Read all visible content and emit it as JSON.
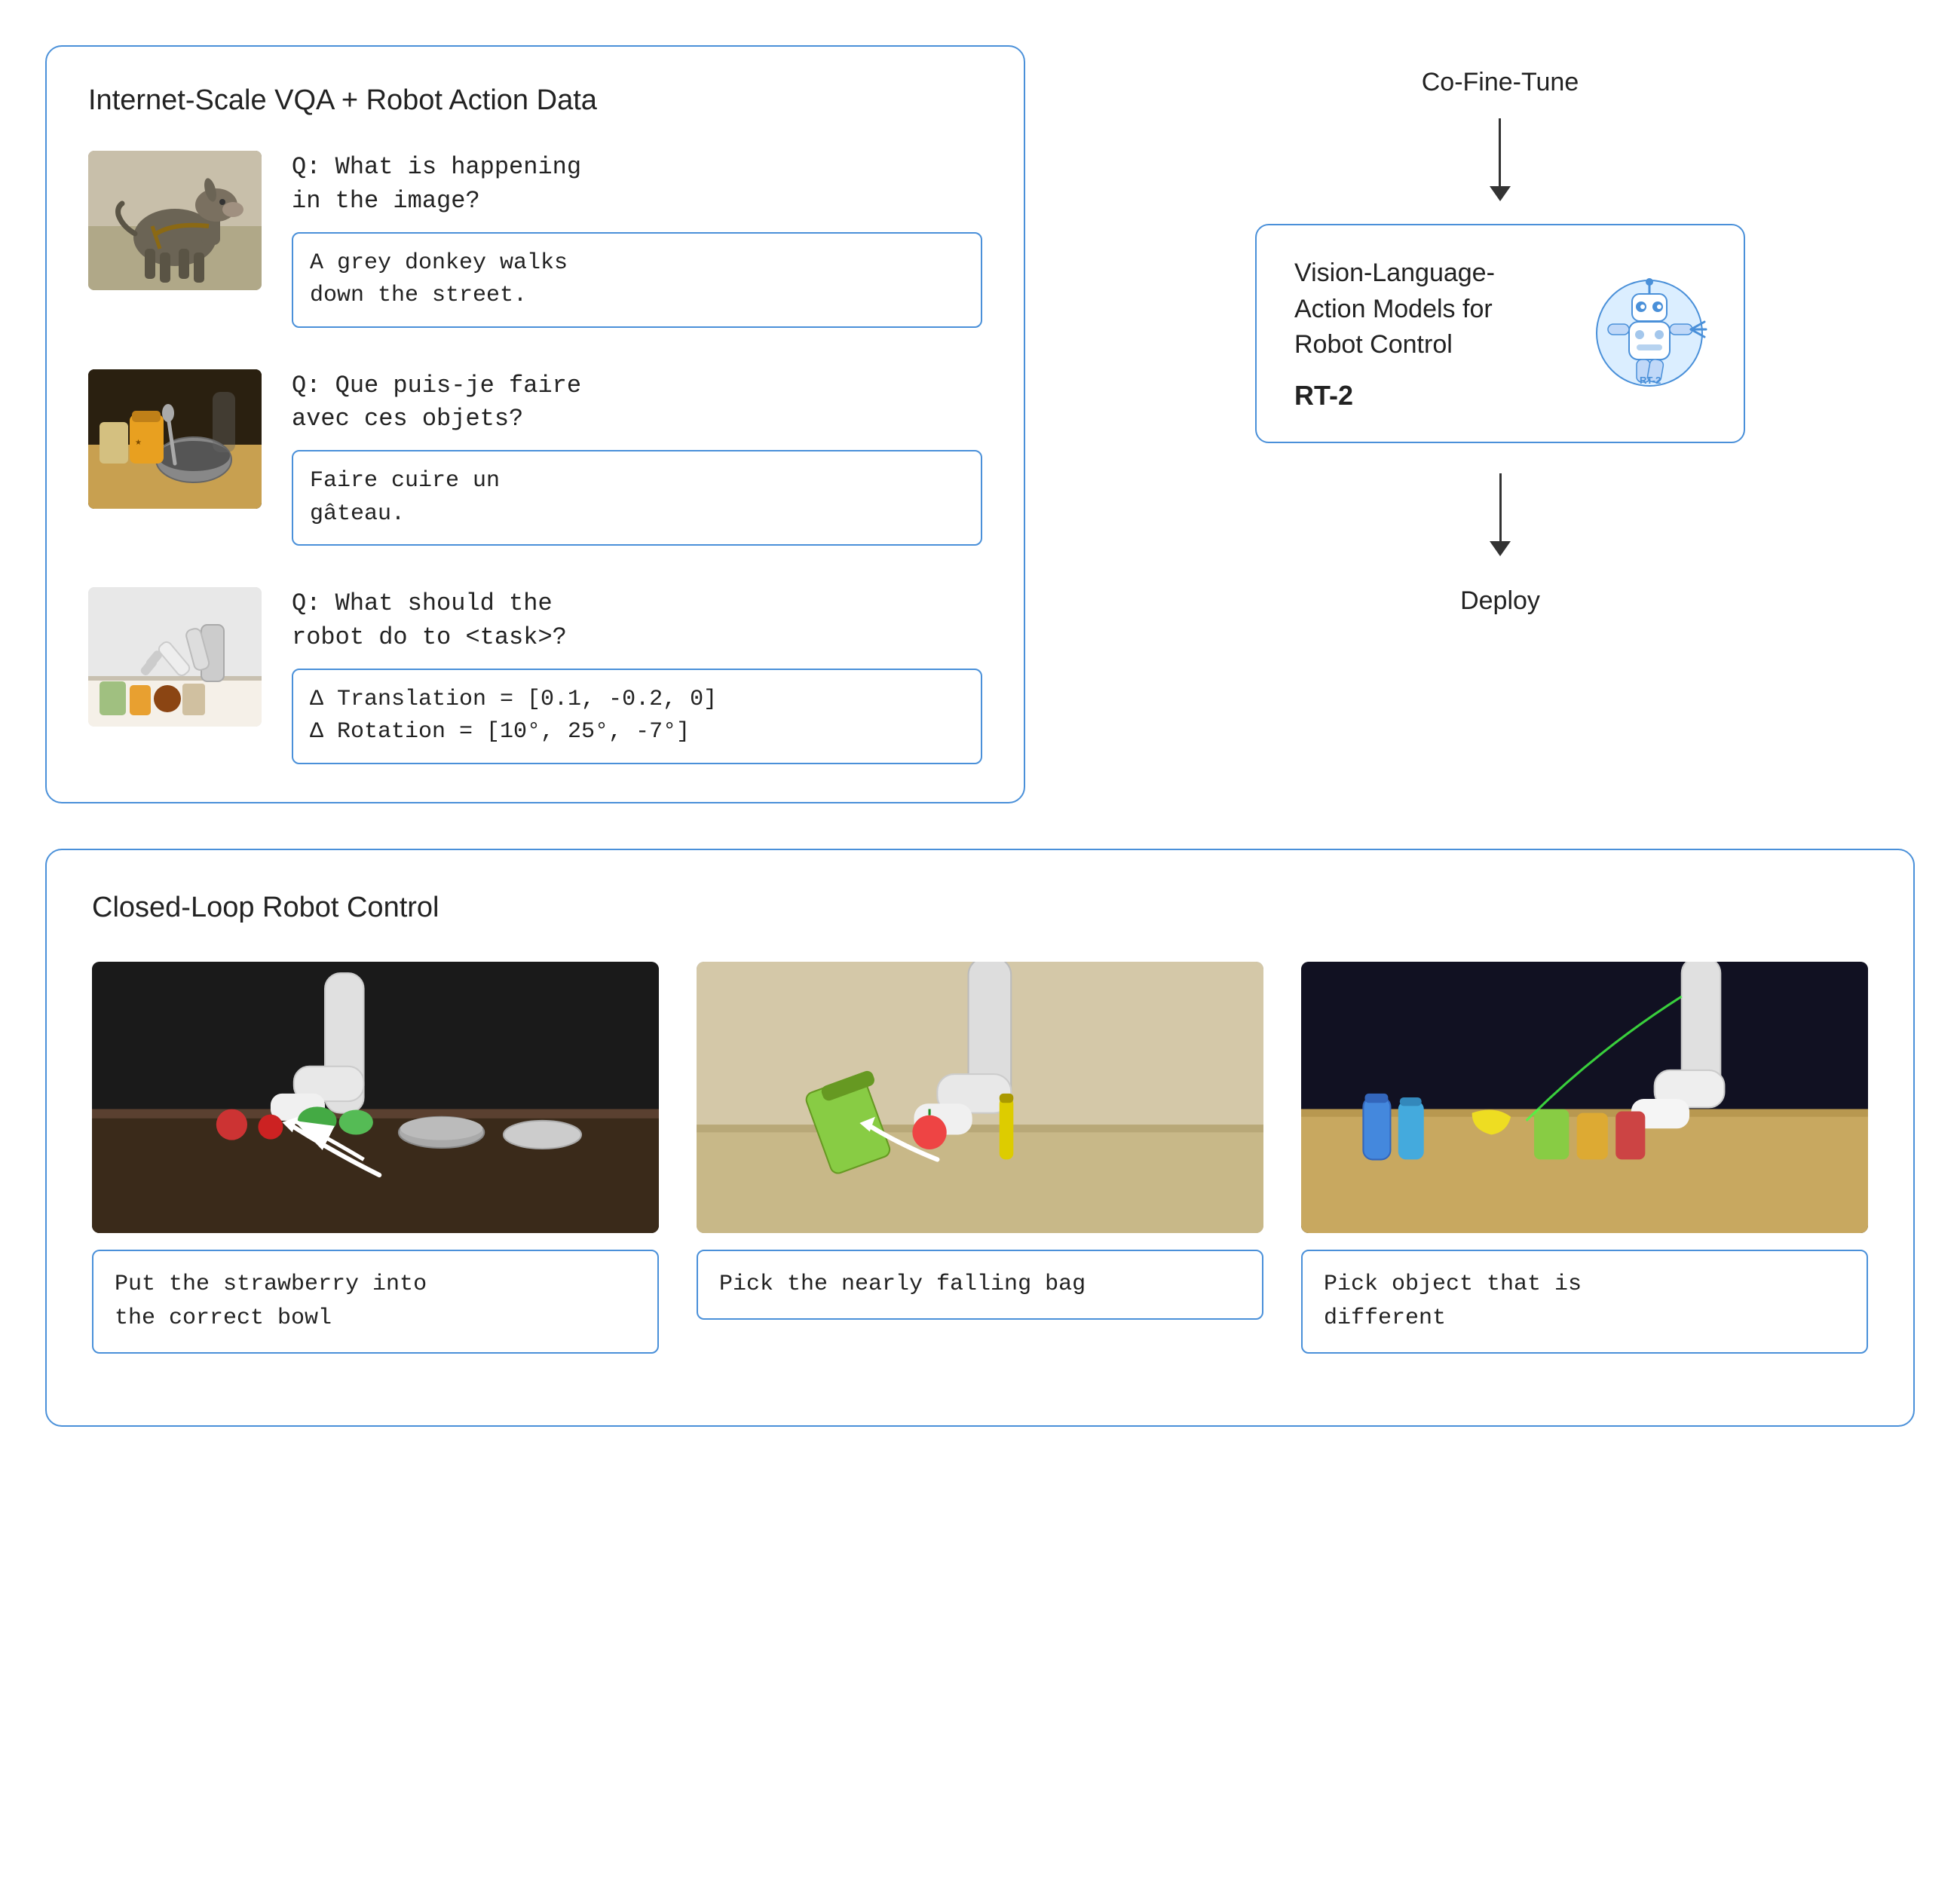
{
  "top_left_box": {
    "title": "Internet-Scale VQA + Robot Action Data",
    "rows": [
      {
        "question": "Q: What is happening\nin the image?",
        "answer": "A grey donkey walks\ndown the street.",
        "image_type": "donkey"
      },
      {
        "question": "Q: Que puis-je faire\navec ces objets?",
        "answer": "Faire cuire un\ngâteau.",
        "image_type": "kitchen"
      },
      {
        "question": "Q: What should the\nrobot do to <task>?",
        "answer": "Δ Translation = [0.1, -0.2, 0]\nΔ Rotation = [10°, 25°, -7°]",
        "image_type": "robot_arm"
      }
    ]
  },
  "co_fine_tune": {
    "label": "Co-Fine-Tune"
  },
  "vla_box": {
    "title": "Vision-Language-\nAction Models for\nRobot Control",
    "model_name": "RT-2"
  },
  "deploy": {
    "label": "Deploy"
  },
  "bottom_box": {
    "title": "Closed-Loop Robot Control",
    "items": [
      {
        "image_type": "robot1",
        "caption": "Put the strawberry into\nthe correct bowl"
      },
      {
        "image_type": "robot2",
        "caption": "Pick the nearly falling bag"
      },
      {
        "image_type": "robot3",
        "caption": "Pick object that is\ndifferent"
      }
    ]
  }
}
